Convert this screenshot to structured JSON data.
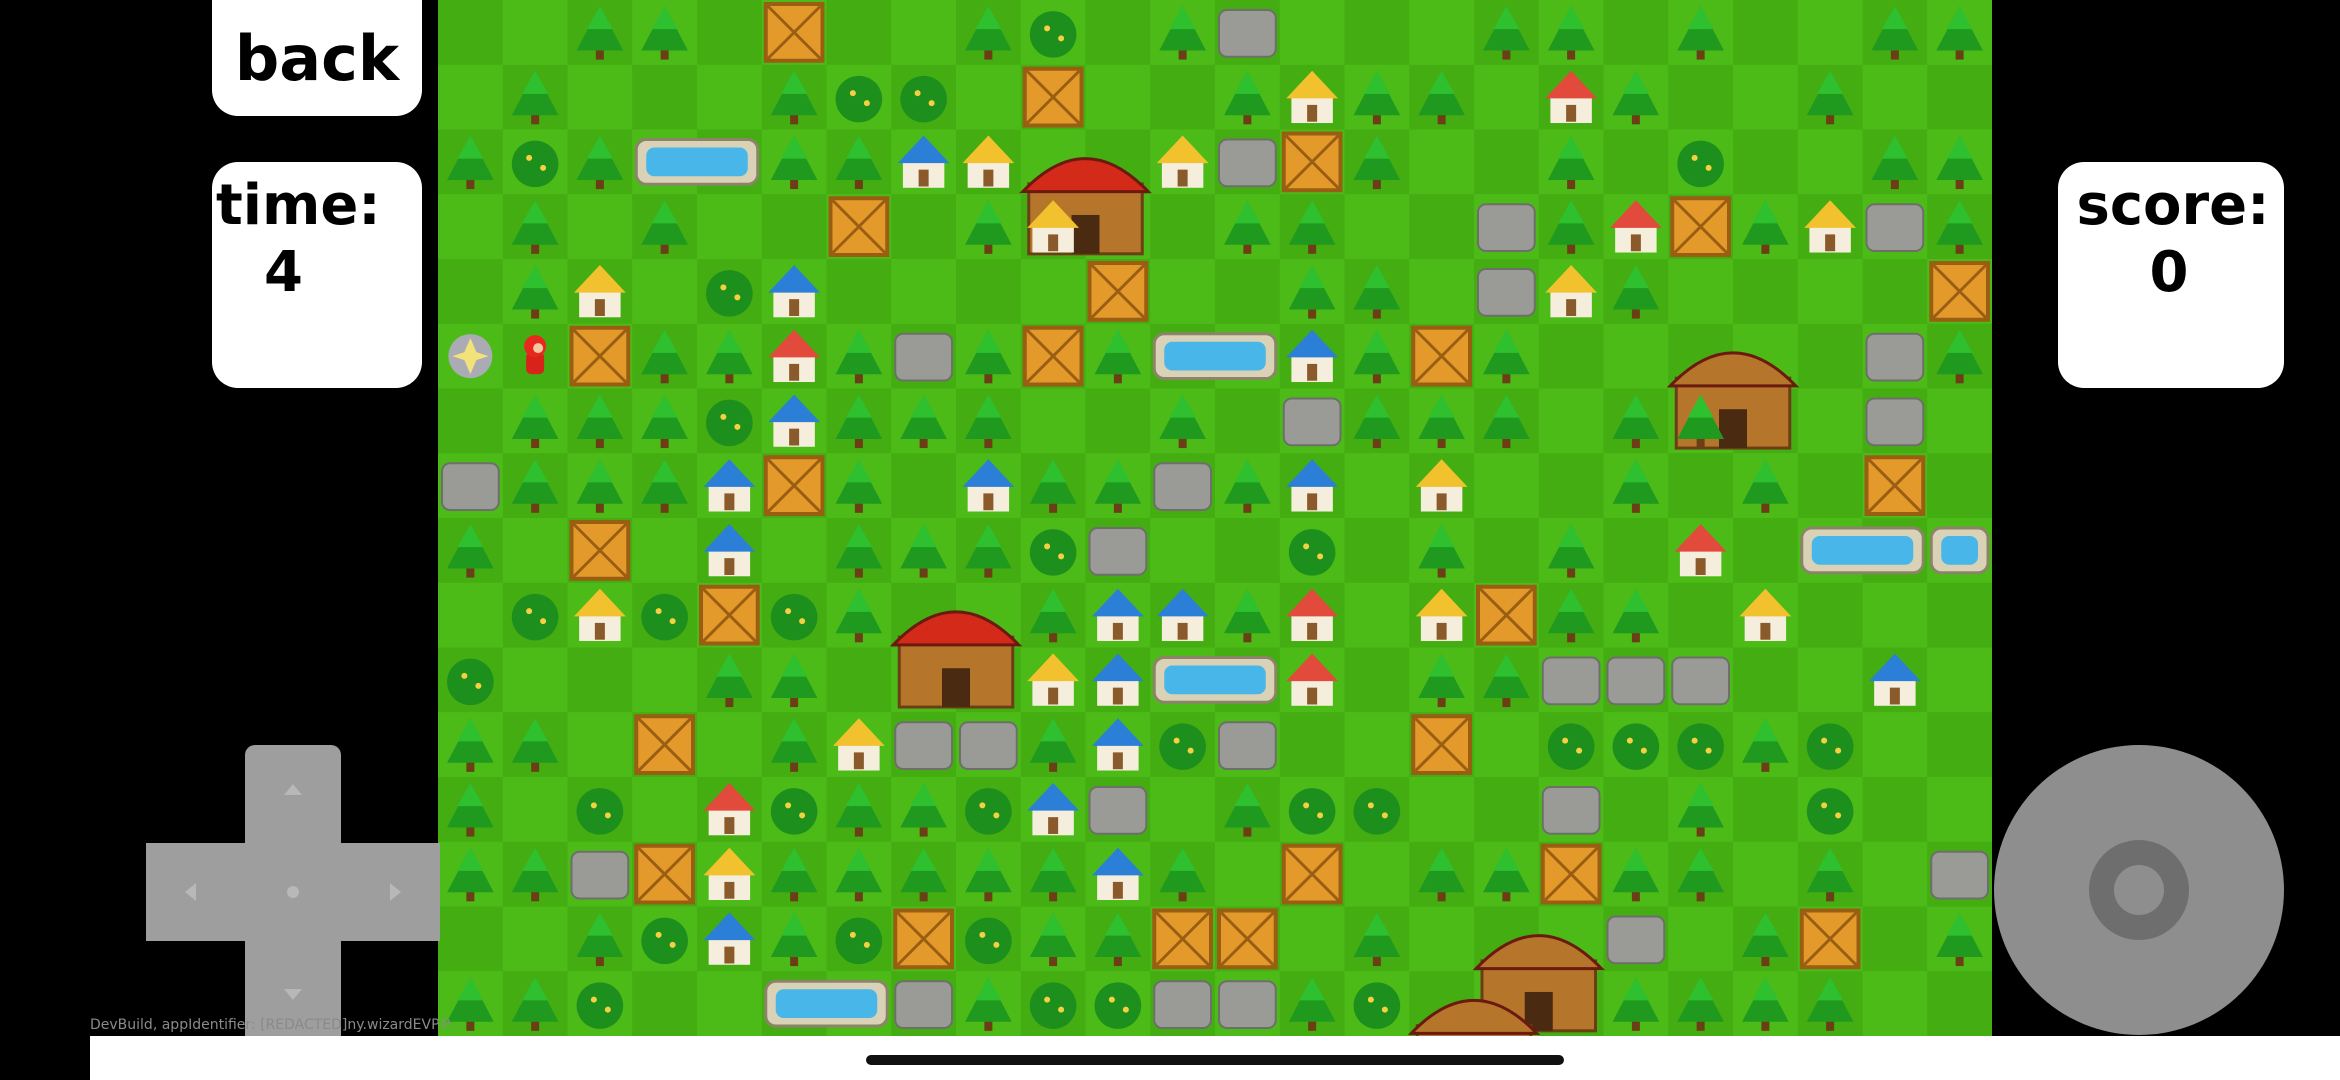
{
  "ui": {
    "back_label": "back",
    "time_label": "time:",
    "time_value": "4",
    "score_label": "score:",
    "score_value": "0",
    "dev_build_text": "DevBuild, appIdentifier: [REDACTED]ny.wizardEVP.P..."
  },
  "board": {
    "cols": 24,
    "rows": 16,
    "legend": {
      ".": "grass",
      "T": "tree",
      "S": "bush",
      "C": "crate",
      "R": "rock",
      "P": "pond",
      "b": "blue-house",
      "y": "yellow-house",
      "r": "red-house",
      "M": "red-barn",
      "W": "wooden-hut",
      "H": "player",
      "G": "sparkle-portal"
    },
    "map": [
      "..TT.C..TS.TR...TT.T..TT",
      ".T...TSS.C..TyTT.rT..T..",
      "TSTPPTTbyMMyRCT..T.S..TT",
      ".T.T..C.TyMMTT..RTrCTyRT",
      ".Ty.Sb....C..TT.RyT....C",
      "GHCTTrTRTCTPPbTCT..WW.RT",
      ".TTTSbTTT..T.RTTT.TTWWR.",
      "RTTTbCT.bTTRTb.y..T.T.C..",
      "T.C.b.TTTSR..S.T.T.r.PPP",
      ".SySCSTMMTbbTr.yCTT.y...",
      "S...TT.MMybPPr.TTRRR..b.",
      "TT.C.TyRRTbSR..C.SSSTS..",
      "T.S.rSTTSbR.TSS..R.T.S..",
      "TTRCyTTTTTbT.C.TTCTT.T.R",
      "..TSbTSCSTTCC.T.WWR.TC.T",
      "TTS..PPRTSSRRTSWW.TTTT.."
    ],
    "colors": {
      "grass_a": "#4cbb17",
      "grass_b": "#43ad12",
      "tree": "#1f9a1f",
      "crate": "#e39a2a",
      "rock": "#9a9a96",
      "pond": "#48b6e8",
      "blue_roof": "#2b7fd6",
      "yellow_roof": "#f2c12e",
      "red_roof": "#e24a3b",
      "barn_roof": "#d42a1a",
      "wood": "#b5752a"
    }
  },
  "controls": {
    "dpad_color": "#9e9e9e",
    "action_button_color": "#8e8e8e"
  }
}
